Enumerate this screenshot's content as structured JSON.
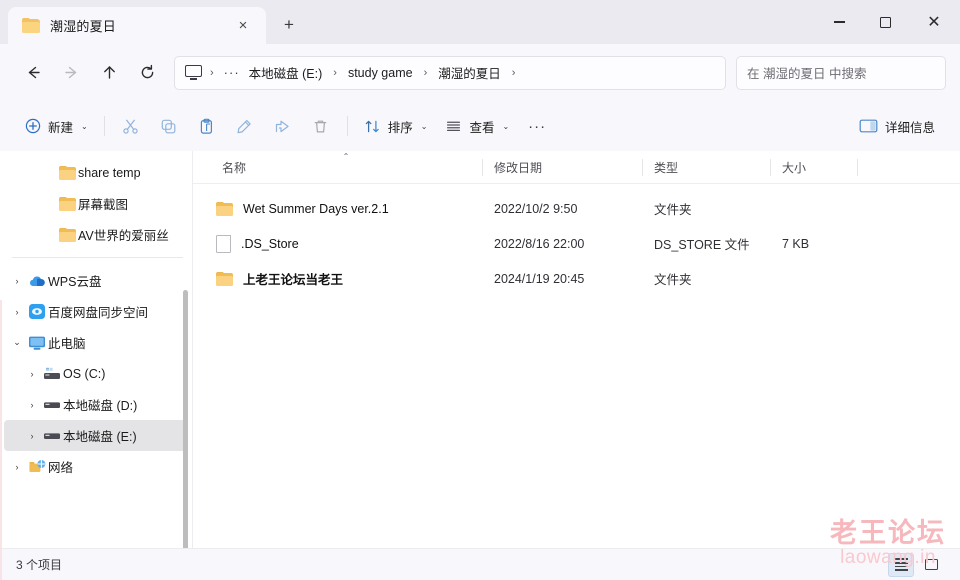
{
  "window": {
    "controls": {
      "minimize_label": "最小化",
      "maximize_label": "最大化",
      "close_label": "关闭"
    }
  },
  "tabs": {
    "items": [
      {
        "title": "潮湿的夏日",
        "icon": "folder-icon",
        "close_label": "×"
      }
    ],
    "new_tab_label": "+"
  },
  "navbar": {
    "back_label": "返回",
    "forward_label": "前进",
    "up_label": "向上",
    "refresh_label": "刷新",
    "breadcrumb": {
      "root_icon": "this-pc-icon",
      "overflow": "···",
      "items": [
        {
          "label": "本地磁盘 (E:)"
        },
        {
          "label": "study game"
        },
        {
          "label": "潮湿的夏日"
        }
      ],
      "separator": "›"
    },
    "search": {
      "placeholder": "在 潮湿的夏日 中搜索",
      "value": ""
    }
  },
  "toolbar": {
    "new_label": "新建",
    "cut_label": "剪切",
    "copy_label": "复制",
    "paste_label": "粘贴",
    "rename_label": "重命名",
    "share_label": "共享",
    "delete_label": "删除",
    "sort_label": "排序",
    "view_label": "查看",
    "more_label": "···",
    "details_label": "详细信息",
    "chevron": "⌄"
  },
  "sidebar": {
    "quick_items": [
      {
        "label": "share temp",
        "icon": "folder-icon",
        "indent": 2,
        "chevron": ""
      },
      {
        "label": "屏幕截图",
        "icon": "folder-icon",
        "indent": 2,
        "chevron": ""
      },
      {
        "label": "AV世界的爱丽丝",
        "icon": "folder-icon",
        "indent": 2,
        "chevron": ""
      }
    ],
    "tree_items": [
      {
        "label": "WPS云盘",
        "icon": "cloud-icon",
        "indent": 0,
        "chevron": "›",
        "selected": false
      },
      {
        "label": "百度网盘同步空间",
        "icon": "baidu-disk-icon",
        "indent": 0,
        "chevron": "›",
        "selected": false
      },
      {
        "label": "此电脑",
        "icon": "this-pc-icon",
        "indent": 0,
        "chevron": "⌄",
        "selected": false
      },
      {
        "label": "OS (C:)",
        "icon": "system-drive-icon",
        "indent": 1,
        "chevron": "›",
        "selected": false
      },
      {
        "label": "本地磁盘 (D:)",
        "icon": "drive-icon",
        "indent": 1,
        "chevron": "›",
        "selected": false
      },
      {
        "label": "本地磁盘 (E:)",
        "icon": "drive-icon",
        "indent": 1,
        "chevron": "›",
        "selected": true
      },
      {
        "label": "网络",
        "icon": "network-icon",
        "indent": 0,
        "chevron": "›",
        "selected": false
      }
    ]
  },
  "filelist": {
    "columns": [
      {
        "key": "name",
        "label": "名称",
        "sorted": true,
        "sort_mark": "⌃"
      },
      {
        "key": "date",
        "label": "修改日期",
        "sorted": false,
        "sort_mark": ""
      },
      {
        "key": "type",
        "label": "类型",
        "sorted": false,
        "sort_mark": ""
      },
      {
        "key": "size",
        "label": "大小",
        "sorted": false,
        "sort_mark": ""
      }
    ],
    "rows": [
      {
        "icon": "folder-icon",
        "name": "Wet Summer Days ver.2.1",
        "date": "2022/10/2 9:50",
        "type": "文件夹",
        "size": "",
        "bold": false
      },
      {
        "icon": "file-icon",
        "name": ".DS_Store",
        "date": "2022/8/16 22:00",
        "type": "DS_STORE 文件",
        "size": "7 KB",
        "bold": false
      },
      {
        "icon": "folder-icon",
        "name": "上老王论坛当老王",
        "date": "2024/1/19 20:45",
        "type": "文件夹",
        "size": "",
        "bold": true
      }
    ]
  },
  "statusbar": {
    "item_count_text": "3 个项目",
    "view_details_label": "详细信息视图",
    "view_large_label": "大图标视图"
  },
  "watermark": {
    "line1": "老王论坛",
    "line2": "laowang.in",
    "color": "#f6b8bd"
  }
}
